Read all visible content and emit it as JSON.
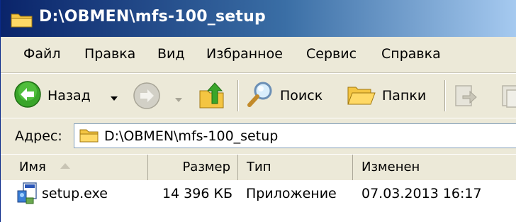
{
  "window": {
    "title": "D:\\OBMEN\\mfs-100_setup"
  },
  "menu": [
    {
      "label": "Файл"
    },
    {
      "label": "Правка"
    },
    {
      "label": "Вид"
    },
    {
      "label": "Избранное"
    },
    {
      "label": "Сервис"
    },
    {
      "label": "Справка"
    }
  ],
  "toolbar": {
    "back_label": "Назад",
    "search_label": "Поиск",
    "folders_label": "Папки"
  },
  "address": {
    "label": "Адрес:",
    "value": "D:\\OBMEN\\mfs-100_setup"
  },
  "columns": {
    "name": "Имя",
    "size": "Размер",
    "type": "Тип",
    "modified": "Изменен"
  },
  "files": [
    {
      "name": "setup.exe",
      "size": "14 396 КБ",
      "type": "Приложение",
      "modified": "07.03.2013 16:17"
    }
  ],
  "colors": {
    "titlebar_start": "#0a246a",
    "titlebar_end": "#a6caf0",
    "back_button": "#3aa52a",
    "chrome": "#ece9d8"
  }
}
